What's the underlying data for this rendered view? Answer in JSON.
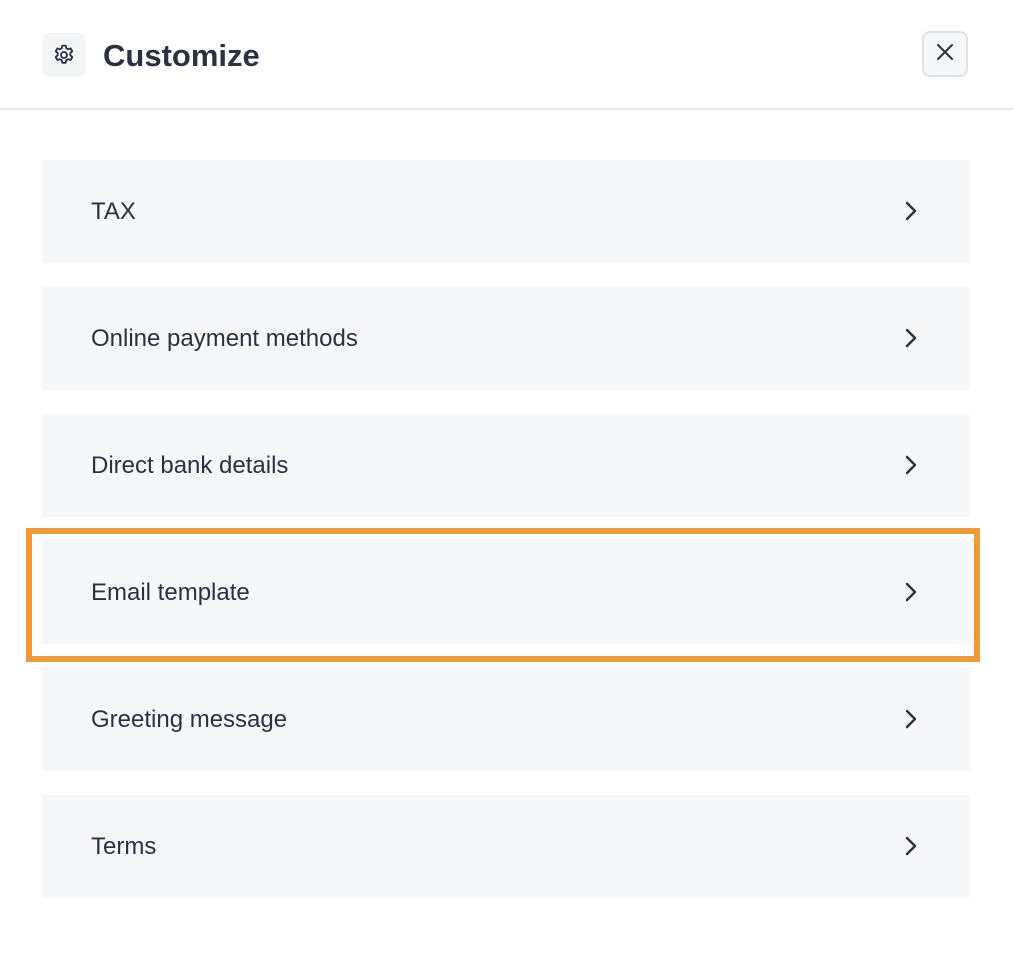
{
  "header": {
    "title": "Customize",
    "icon": "gear-icon",
    "close_icon": "close-icon"
  },
  "menu": {
    "items": [
      {
        "label": "TAX",
        "icon": "chevron-right-icon"
      },
      {
        "label": "Online payment methods",
        "icon": "chevron-right-icon"
      },
      {
        "label": "Direct bank details",
        "icon": "chevron-right-icon"
      },
      {
        "label": "Email template",
        "icon": "chevron-right-icon",
        "highlighted": true
      },
      {
        "label": "Greeting message",
        "icon": "chevron-right-icon"
      },
      {
        "label": "Terms",
        "icon": "chevron-right-icon"
      }
    ]
  },
  "colors": {
    "text": "#2b3140",
    "item_background": "#f6f7f9",
    "highlight": "#ec9a3c",
    "divider": "#e8eaee"
  }
}
